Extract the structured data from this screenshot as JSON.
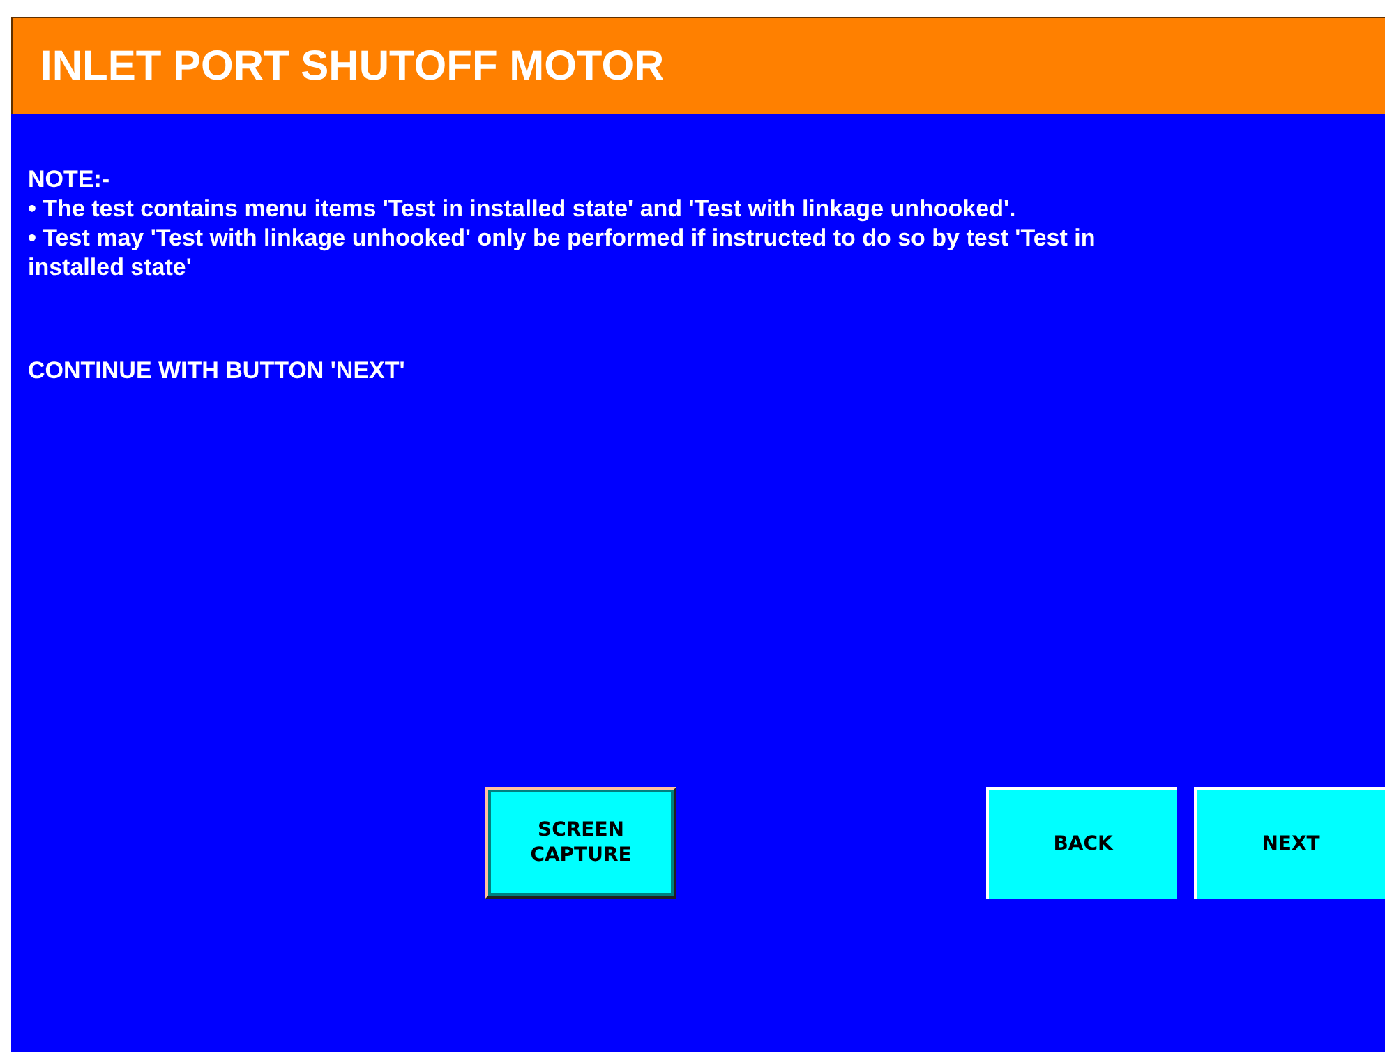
{
  "header": {
    "title": "INLET PORT SHUTOFF MOTOR"
  },
  "note": {
    "heading": "NOTE:-",
    "bullets": [
      "• The test contains menu items 'Test in installed state' and 'Test with linkage unhooked'.",
      "• Test may 'Test with linkage unhooked' only be performed if instructed to do so by test 'Test in installed state'"
    ],
    "instruction": "CONTINUE WITH BUTTON 'NEXT'"
  },
  "buttons": [
    {
      "label": "SCREEN CAPTURE",
      "kind": "framed"
    },
    {
      "label": "BACK",
      "kind": "flat"
    },
    {
      "label": "NEXT",
      "kind": "flat"
    }
  ]
}
